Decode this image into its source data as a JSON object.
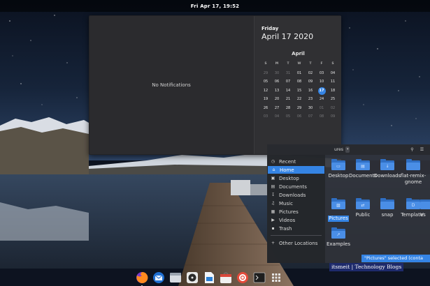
{
  "topbar": {
    "clock": "Fri Apr 17, 19:52"
  },
  "popover": {
    "no_notifications": "No Notifications",
    "calendar": {
      "weekday": "Friday",
      "full_date": "April 17 2020",
      "month": "April",
      "day_headers": [
        "S",
        "M",
        "T",
        "W",
        "T",
        "F",
        "S"
      ],
      "weeks": [
        [
          "29",
          "30",
          "31",
          "01",
          "02",
          "03",
          "04"
        ],
        [
          "05",
          "06",
          "07",
          "08",
          "09",
          "10",
          "11"
        ],
        [
          "12",
          "13",
          "14",
          "15",
          "16",
          "17",
          "18"
        ],
        [
          "19",
          "20",
          "21",
          "22",
          "23",
          "24",
          "25"
        ],
        [
          "26",
          "27",
          "28",
          "29",
          "30",
          "01",
          "02"
        ],
        [
          "03",
          "04",
          "05",
          "06",
          "07",
          "08",
          "09"
        ]
      ],
      "today": "17"
    }
  },
  "file_manager": {
    "path_label": "ures",
    "sidebar": {
      "items": [
        {
          "label": "Recent",
          "icon": "clock-icon"
        },
        {
          "label": "Home",
          "icon": "home-icon",
          "active": true
        },
        {
          "label": "Desktop",
          "icon": "desktop-icon"
        },
        {
          "label": "Documents",
          "icon": "document-icon"
        },
        {
          "label": "Downloads",
          "icon": "download-icon"
        },
        {
          "label": "Music",
          "icon": "music-icon"
        },
        {
          "label": "Pictures",
          "icon": "picture-icon"
        },
        {
          "label": "Videos",
          "icon": "video-icon"
        },
        {
          "label": "Trash",
          "icon": "trash-icon"
        }
      ],
      "other_locations": "Other Locations"
    },
    "folders": [
      {
        "label": "Desktop",
        "icon": "desktop-folder-icon"
      },
      {
        "label": "Documents",
        "icon": "documents-folder-icon"
      },
      {
        "label": "Downloads",
        "icon": "downloads-folder-icon"
      },
      {
        "label": "flat-remix-gnome",
        "icon": "folder-icon"
      },
      {
        "label": "Pictures",
        "icon": "pictures-folder-icon",
        "selected": true
      },
      {
        "label": "Public",
        "icon": "public-folder-icon"
      },
      {
        "label": "snap",
        "icon": "folder-icon"
      },
      {
        "label": "Templates",
        "icon": "templates-folder-icon"
      },
      {
        "label": "V",
        "icon": "videos-folder-icon"
      },
      {
        "label": "Examples",
        "icon": "examples-folder-icon"
      }
    ],
    "status": "\"Pictures\" selected (conta"
  },
  "watermark": "itsmeit | Technology Blogs",
  "dock": {
    "apps": [
      {
        "name": "firefox",
        "icon": "firefox-icon",
        "color": "#e66000"
      },
      {
        "name": "thunderbird",
        "icon": "thunderbird-icon",
        "color": "#3d8ee6"
      },
      {
        "name": "files",
        "icon": "files-icon",
        "color": "#cfd3da"
      },
      {
        "name": "rhythmbox",
        "icon": "rhythmbox-icon",
        "color": "#444a55"
      },
      {
        "name": "libreoffice-writer",
        "icon": "writer-icon",
        "color": "#e9edf3"
      },
      {
        "name": "software",
        "icon": "software-icon",
        "color": "#d54b3a"
      },
      {
        "name": "help",
        "icon": "help-icon",
        "color": "#e6e6e6"
      },
      {
        "name": "terminal",
        "icon": "terminal-icon",
        "color": "#2c2c2c"
      },
      {
        "name": "show-applications",
        "icon": "app-grid-icon",
        "color": "#3a3a3a"
      }
    ]
  },
  "colors": {
    "accent": "#3584e4",
    "popover_bg": "#2b2b2e",
    "watermark_bg": "#1d2a6b"
  }
}
